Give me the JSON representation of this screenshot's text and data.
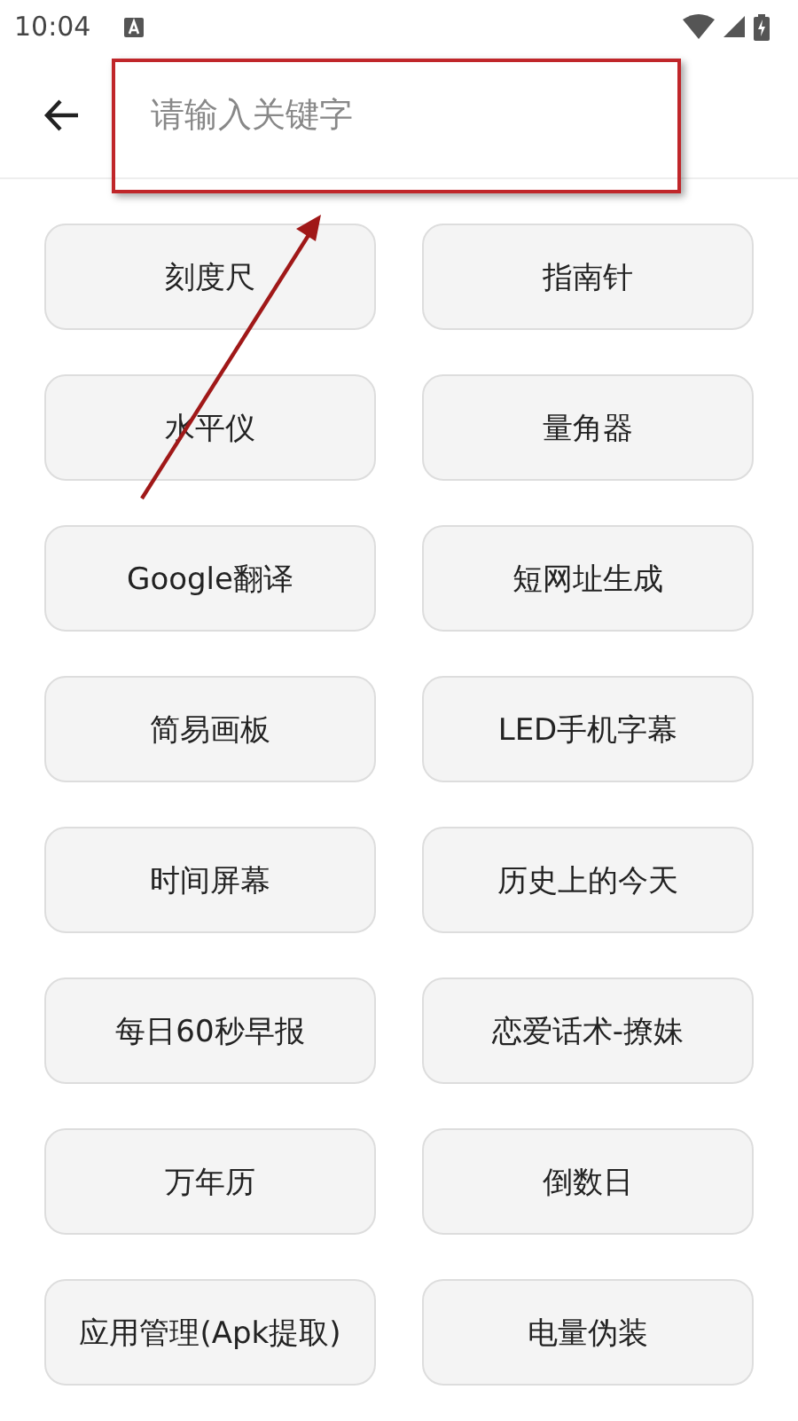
{
  "status_bar": {
    "time": "10:04"
  },
  "search": {
    "placeholder": "请输入关键字"
  },
  "tools": [
    {
      "label": "刻度尺"
    },
    {
      "label": "指南针"
    },
    {
      "label": "水平仪"
    },
    {
      "label": "量角器"
    },
    {
      "label": "Google翻译"
    },
    {
      "label": "短网址生成"
    },
    {
      "label": "简易画板"
    },
    {
      "label": "LED手机字幕"
    },
    {
      "label": "时间屏幕"
    },
    {
      "label": "历史上的今天"
    },
    {
      "label": "每日60秒早报"
    },
    {
      "label": "恋爱话术-撩妹"
    },
    {
      "label": "万年历"
    },
    {
      "label": "倒数日"
    },
    {
      "label": "应用管理(Apk提取)"
    },
    {
      "label": "电量伪装"
    }
  ]
}
